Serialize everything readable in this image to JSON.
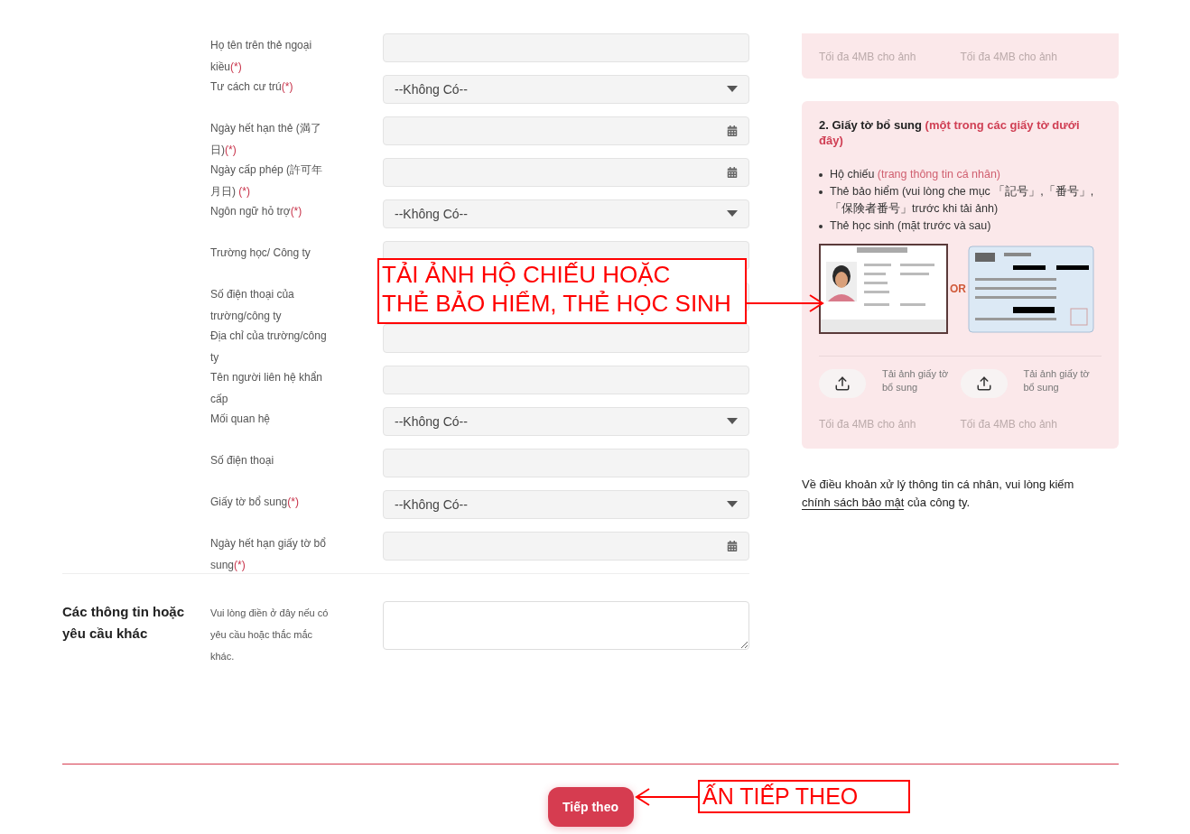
{
  "form": {
    "rows": [
      {
        "label": "Họ tên trên thẻ ngoại kiều",
        "mark": "(*)",
        "kind": "text"
      },
      {
        "label": "Tư cách cư trú",
        "mark": "(*)",
        "kind": "select",
        "value": "--Không Có--"
      },
      {
        "label": "Ngày hết hạn thẻ (満了日)",
        "mark": "(*)",
        "kind": "date"
      },
      {
        "label": "Ngày cấp phép (許可年月日) ",
        "mark": "(*)",
        "kind": "date"
      },
      {
        "label": "Ngôn ngữ hỏ trợ",
        "mark": "(*)",
        "kind": "select",
        "value": "--Không Có--"
      },
      {
        "label": "Trường học/ Công ty",
        "kind": "text"
      },
      {
        "label": "Số điện thoại của trường/công ty",
        "kind": "text"
      },
      {
        "label": "Địa chỉ của trường/công ty",
        "kind": "text"
      },
      {
        "label": "Tên người liên hệ khẩn cấp",
        "kind": "text"
      },
      {
        "label": "Mối quan hệ",
        "kind": "select",
        "value": "--Không Có--"
      },
      {
        "label": "Số điện thoại",
        "kind": "text"
      },
      {
        "label": "Giấy tờ bổ sung",
        "mark": "(*)",
        "kind": "select",
        "value": "--Không Có--"
      },
      {
        "label": "Ngày hết hạn giấy tờ bổ sung",
        "mark": "(*)",
        "kind": "date"
      }
    ]
  },
  "other": {
    "heading": "Các thông tin hoặc yêu cầu khác",
    "label": "Vui lòng điền ở đây nếu có yêu cầu hoặc thắc mắc khác."
  },
  "upload_card_top": {
    "limits": [
      "Tối đa 4MB cho ảnh",
      "Tối đa 4MB cho ảnh"
    ]
  },
  "upload_card": {
    "title": "2. Giấy tờ bổ sung",
    "title_note": "(một trong các giấy tờ dưới đây)",
    "bullets": [
      {
        "text": "Hộ chiếu",
        "note": "(trang thông tin cá nhân)"
      },
      {
        "text": "Thẻ bảo hiểm (vui lòng che mục 「記号」,「番号」,「保険者番号」trước khi tải ảnh)"
      },
      {
        "text": "Thẻ học sinh (mặt trước và sau)"
      }
    ],
    "separator": "OR",
    "uploads": [
      {
        "label": "Tải ảnh giấy tờ bổ sung",
        "limit": "Tối đa 4MB cho ảnh"
      },
      {
        "label": "Tải ảnh giấy tờ bổ sung",
        "limit": "Tối đa 4MB cho ảnh"
      }
    ]
  },
  "policy": {
    "before": "Về điều khoản xử lý thông tin cá nhân, vui lòng kiếm ",
    "link": "chính sách bảo mật",
    "after": " của công ty."
  },
  "next_button": "Tiếp theo",
  "annotations": [
    {
      "lines": [
        "TẢI ẢNH HỘ CHIẾU HOẶC",
        "THẺ BẢO HIỂM, THẺ HỌC SINH"
      ]
    },
    {
      "lines": [
        "ẤN TIẾP THEO"
      ]
    }
  ]
}
